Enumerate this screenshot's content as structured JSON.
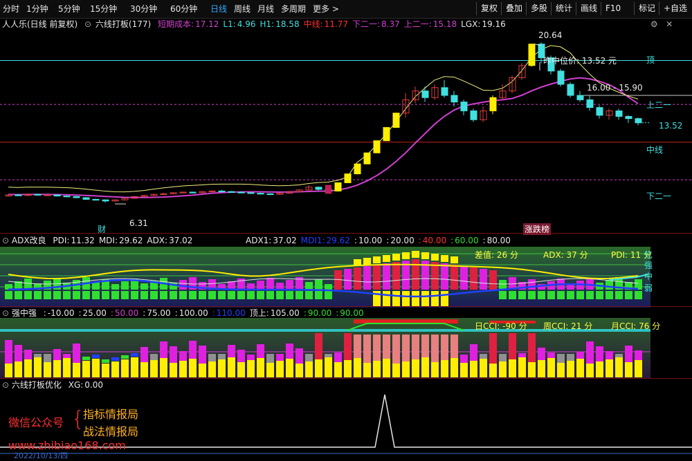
{
  "toolbar": {
    "periods": [
      "分时",
      "1分钟",
      "5分钟",
      "15分钟",
      "30分钟",
      "60分钟",
      "日线",
      "周线",
      "月线",
      "多周期",
      "更多 >"
    ],
    "active_period": "日线",
    "right_buttons": [
      "复权",
      "叠加",
      "多股",
      "统计",
      "画线",
      "F10",
      "标记",
      "+自选"
    ]
  },
  "main": {
    "stock": "人人乐(日线 前复权)",
    "indicator_name": "六线打板(177)",
    "params": [
      {
        "label": "短期成本:",
        "value": "17.12",
        "color": "#d040d0"
      },
      {
        "label": "L1:",
        "value": "4.96",
        "color": "#40e0e0"
      },
      {
        "label": "H1:",
        "value": "18.58",
        "color": "#40e0e0"
      },
      {
        "label": "中线:",
        "value": "11.77",
        "color": "#ff3030"
      },
      {
        "label": "下二一:",
        "value": "8.37",
        "color": "#d040d0"
      },
      {
        "label": "上二一:",
        "value": "15.18",
        "color": "#d040d0"
      },
      {
        "label": "LGX:",
        "value": "19.16",
        "color": "#e8e8e8"
      }
    ],
    "high_label": "20.64",
    "low_label": "6.31",
    "last_label": "13.52",
    "prev_price_label": "昨中位价: 13.52 元",
    "range_label": "16.00 - 15.90",
    "cai_label": "财",
    "zdb_label": "涨跌榜",
    "line_labels": {
      "top": "顶",
      "upper": "上二一",
      "mid": "中线",
      "lower": "下二一"
    }
  },
  "adx": {
    "name": "ADX改良",
    "params": [
      {
        "label": "PDI:",
        "value": "11.32",
        "color": "#e8e8e8"
      },
      {
        "label": "MDI:",
        "value": "29.62",
        "color": "#e8e8e8"
      },
      {
        "label": "ADX:",
        "value": "37.02",
        "color": "#e8e8e8"
      }
    ],
    "params2": [
      {
        "label": "ADX1:",
        "value": "37.02",
        "color": "#e8e8e8"
      },
      {
        "label": "MDI1:",
        "value": "29.62",
        "color": "#2040ff"
      },
      {
        "label": ":",
        "value": "10.00",
        "color": "#e8e8e8"
      },
      {
        "label": ":",
        "value": "20.00",
        "color": "#e8e8e8"
      },
      {
        "label": ":",
        "value": "40.00",
        "color": "#ff3030"
      },
      {
        "label": ":",
        "value": "60.00",
        "color": "#30e030"
      },
      {
        "label": ":",
        "value": "80.00",
        "color": "#e8e8e8"
      }
    ],
    "diff": "差值: 26 分",
    "adx_score": "ADX: 37 分",
    "pdi_score": "PDI: 11 分",
    "side": [
      "强",
      "中",
      "弱"
    ],
    "side_top": "忆"
  },
  "strength": {
    "name": "强中强",
    "params": [
      {
        "label": ":",
        "value": "-10.00",
        "color": "#e8e8e8"
      },
      {
        "label": ":",
        "value": "25.00",
        "color": "#e8e8e8"
      },
      {
        "label": ":",
        "value": "50.00",
        "color": "#d040d0"
      },
      {
        "label": ":",
        "value": "75.00",
        "color": "#e8e8e8"
      },
      {
        "label": ":",
        "value": "100.00",
        "color": "#e8e8e8"
      },
      {
        "label": ":",
        "value": "110.00",
        "color": "#2040ff"
      },
      {
        "label": "顶上:",
        "value": "105.00",
        "color": "#e8e8e8"
      },
      {
        "label": ":",
        "value": "90.00",
        "color": "#30e030"
      },
      {
        "label": ":",
        "value": "90.00",
        "color": "#30e030"
      }
    ],
    "cci_day": "日CCI: -90 分",
    "cci_week": "周CCI: 21 分",
    "cci_month": "月CCI: 76 分"
  },
  "xg": {
    "name": "六线打板优化",
    "params": [
      {
        "label": "XG:",
        "value": "0.00",
        "color": "#e8e8e8"
      }
    ]
  },
  "watermark": {
    "line1": "微信公众号",
    "line2a": "指标情报局",
    "line2b": "战法情报局",
    "url": "www.zhibiao168.com"
  },
  "date_label": "2022/10/13/四",
  "chart_data": {
    "type": "candlestick",
    "candles": [
      [
        6.9,
        7.0,
        6.85,
        7.05
      ],
      [
        7.0,
        6.95,
        6.9,
        7.1
      ],
      [
        6.95,
        7.05,
        6.9,
        7.1
      ],
      [
        7.05,
        7.0,
        6.95,
        7.1
      ],
      [
        7.0,
        7.0,
        6.95,
        7.05
      ],
      [
        7.0,
        6.9,
        6.85,
        7.05
      ],
      [
        6.9,
        6.85,
        6.8,
        6.95
      ],
      [
        6.85,
        6.75,
        6.7,
        6.9
      ],
      [
        6.75,
        6.6,
        6.55,
        6.8
      ],
      [
        6.6,
        6.55,
        6.5,
        6.65
      ],
      [
        6.55,
        6.45,
        6.31,
        6.6
      ],
      [
        6.45,
        6.55,
        6.4,
        6.6
      ],
      [
        6.55,
        6.7,
        6.5,
        6.75
      ],
      [
        6.7,
        6.85,
        6.65,
        6.9
      ],
      [
        6.85,
        6.95,
        6.8,
        7.0
      ],
      [
        6.95,
        7.05,
        6.9,
        7.1
      ],
      [
        7.05,
        7.1,
        7.0,
        7.2
      ],
      [
        7.1,
        7.2,
        7.05,
        7.25
      ],
      [
        7.2,
        7.25,
        7.15,
        7.3
      ],
      [
        7.25,
        7.2,
        7.15,
        7.3
      ],
      [
        7.2,
        7.3,
        7.15,
        7.35
      ],
      [
        7.3,
        7.35,
        7.25,
        7.4
      ],
      [
        7.35,
        7.3,
        7.25,
        7.45
      ],
      [
        7.3,
        7.25,
        7.2,
        7.35
      ],
      [
        7.25,
        7.2,
        7.15,
        7.3
      ],
      [
        7.2,
        7.15,
        7.1,
        7.25
      ],
      [
        7.15,
        7.1,
        7.05,
        7.2
      ],
      [
        7.1,
        7.05,
        7.0,
        7.15
      ],
      [
        7.05,
        7.15,
        7.0,
        7.2
      ],
      [
        7.15,
        7.3,
        7.1,
        7.35
      ],
      [
        7.3,
        7.45,
        7.25,
        7.5
      ],
      [
        7.45,
        7.7,
        7.4,
        7.9
      ],
      [
        7.7,
        7.5,
        7.4,
        7.75
      ],
      [
        7.5,
        7.35,
        7.3,
        7.55
      ],
      [
        7.35,
        8.1,
        7.3,
        8.1
      ],
      [
        8.1,
        8.9,
        8.1,
        8.9
      ],
      [
        8.9,
        9.8,
        8.9,
        9.8
      ],
      [
        9.8,
        10.8,
        9.8,
        10.8
      ],
      [
        10.8,
        11.9,
        10.8,
        11.9
      ],
      [
        11.9,
        13.1,
        11.9,
        13.1
      ],
      [
        13.1,
        14.4,
        13.1,
        14.4
      ],
      [
        14.4,
        15.6,
        14.0,
        16.2
      ],
      [
        15.6,
        16.4,
        15.3,
        16.8
      ],
      [
        16.4,
        15.8,
        15.4,
        16.8
      ],
      [
        15.8,
        16.7,
        15.6,
        17.0
      ],
      [
        16.7,
        16.0,
        15.8,
        17.4
      ],
      [
        16.0,
        15.4,
        15.0,
        16.4
      ],
      [
        15.4,
        14.6,
        14.2,
        15.6
      ],
      [
        14.6,
        13.8,
        13.6,
        14.8
      ],
      [
        13.8,
        14.6,
        13.6,
        15.0
      ],
      [
        14.6,
        15.8,
        14.3,
        16.0
      ],
      [
        15.8,
        16.4,
        15.6,
        17.0
      ],
      [
        16.4,
        17.6,
        16.2,
        17.8
      ],
      [
        17.6,
        18.7,
        17.4,
        18.9
      ],
      [
        18.7,
        20.64,
        18.6,
        20.64
      ],
      [
        20.64,
        19.4,
        18.9,
        20.8
      ],
      [
        19.4,
        18.2,
        17.9,
        19.6
      ],
      [
        18.2,
        17.0,
        16.8,
        18.4
      ],
      [
        17.0,
        16.0,
        15.8,
        17.2
      ],
      [
        16.0,
        15.6,
        15.4,
        16.4
      ],
      [
        15.6,
        14.9,
        14.6,
        16.0
      ],
      [
        14.9,
        14.2,
        13.9,
        15.1
      ],
      [
        14.2,
        14.6,
        13.8,
        14.8
      ],
      [
        14.6,
        14.1,
        13.8,
        14.8
      ],
      [
        14.1,
        13.9,
        13.5,
        14.2
      ],
      [
        13.9,
        13.52,
        13.3,
        14.0
      ]
    ]
  }
}
